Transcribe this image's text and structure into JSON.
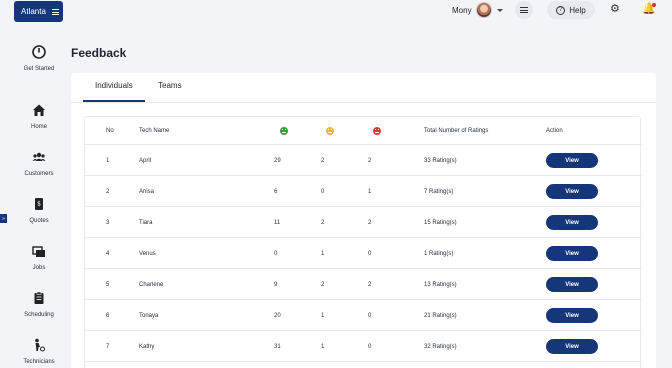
{
  "header": {
    "brand": "Atlanta",
    "user_name": "Mony",
    "help_label": "Help"
  },
  "sidebar": {
    "items": [
      {
        "label": "Get Started",
        "icon": "power-icon"
      },
      {
        "label": "Home",
        "icon": "home-icon"
      },
      {
        "label": "Customers",
        "icon": "users-icon"
      },
      {
        "label": "Quotes",
        "icon": "quote-icon"
      },
      {
        "label": "Jobs",
        "icon": "jobs-icon"
      },
      {
        "label": "Scheduling",
        "icon": "clipboard-icon"
      },
      {
        "label": "Technicians",
        "icon": "technician-icon"
      }
    ],
    "expand_glyph": "»"
  },
  "page": {
    "title": "Feedback"
  },
  "tabs": [
    {
      "label": "Individuals",
      "active": true
    },
    {
      "label": "Teams",
      "active": false
    }
  ],
  "table": {
    "headers": {
      "no": "No",
      "tech": "Tech Name",
      "total": "Total Number of Ratings",
      "action": "Action"
    },
    "faces": {
      "happy": "#2e9e3f",
      "neutral": "#f2b52b",
      "sad": "#d93b3b"
    },
    "rows": [
      {
        "no": "1",
        "name": "April",
        "happy": "29",
        "neutral": "2",
        "sad": "2",
        "total": "33 Rating(s)",
        "action": "View"
      },
      {
        "no": "2",
        "name": "Anisa",
        "happy": "6",
        "neutral": "0",
        "sad": "1",
        "total": "7 Rating(s)",
        "action": "View"
      },
      {
        "no": "3",
        "name": "Tiara",
        "happy": "11",
        "neutral": "2",
        "sad": "2",
        "total": "15 Rating(s)",
        "action": "View"
      },
      {
        "no": "4",
        "name": "Venus",
        "happy": "0",
        "neutral": "1",
        "sad": "0",
        "total": "1 Rating(s)",
        "action": "View"
      },
      {
        "no": "5",
        "name": "Charlene",
        "happy": "9",
        "neutral": "2",
        "sad": "2",
        "total": "13 Rating(s)",
        "action": "View"
      },
      {
        "no": "6",
        "name": "Tonaya",
        "happy": "20",
        "neutral": "1",
        "sad": "0",
        "total": "21 Rating(s)",
        "action": "View"
      },
      {
        "no": "7",
        "name": "Kathy",
        "happy": "31",
        "neutral": "1",
        "sad": "0",
        "total": "32 Rating(s)",
        "action": "View"
      }
    ]
  }
}
